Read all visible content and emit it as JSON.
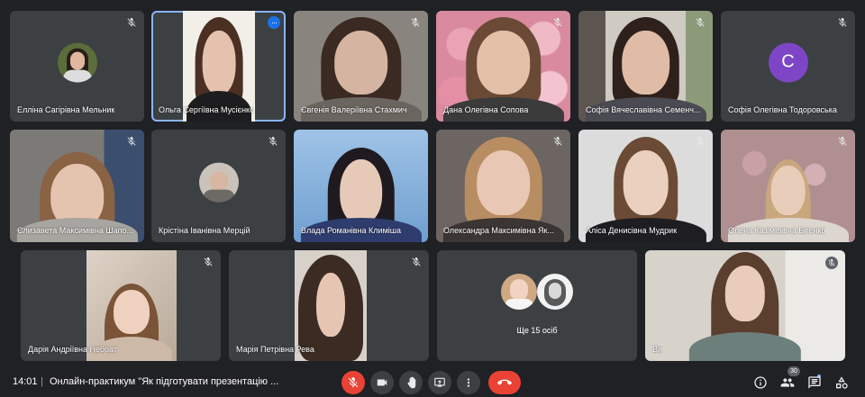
{
  "participants": [
    {
      "name": "Елліна Сагірівна Мельник"
    },
    {
      "name": "Ольга Сергіївна Мусієнко"
    },
    {
      "name": "Євгенія Валеріївна Стахмич"
    },
    {
      "name": "Дана Олегівна Сопова"
    },
    {
      "name": "Софія Вячеславівна Семенч..."
    },
    {
      "name": "Софія Олегівна Тодоровська",
      "avatar_letter": "C"
    },
    {
      "name": "Єлизавета Максимівна Шапо..."
    },
    {
      "name": "Крістіна Іванівна Мерцій"
    },
    {
      "name": "Влада Романівна Климіша"
    },
    {
      "name": "Олександра Максимівна Як..."
    },
    {
      "name": "Аліса Денисівна Мудрик"
    },
    {
      "name": "Олена Казімірівна Бігенко"
    },
    {
      "name": "Дарія Андріївна Небрат"
    },
    {
      "name": "Марія Петрівна Рева"
    },
    {
      "name": "Ви"
    }
  ],
  "more_people": {
    "label": "Ще 15 осіб"
  },
  "bottom_bar": {
    "time": "14:01",
    "separator": "|",
    "meeting_title": "Онлайн-практикум \"Як підготувати презентацію ...",
    "participant_count": "30"
  },
  "icons": {
    "mic_off": "mic-off-icon",
    "camera": "camera-icon",
    "hand": "raise-hand-icon",
    "present": "present-screen-icon",
    "more": "more-vert-icon",
    "leave": "end-call-icon",
    "info": "info-icon",
    "people": "people-icon",
    "chat": "chat-icon",
    "activities": "activities-icon"
  },
  "colors": {
    "background": "#202124",
    "tile": "#3c4043",
    "accent": "#8ab4f8",
    "danger": "#ea4335",
    "avatar_purple": "#7e46c7"
  }
}
